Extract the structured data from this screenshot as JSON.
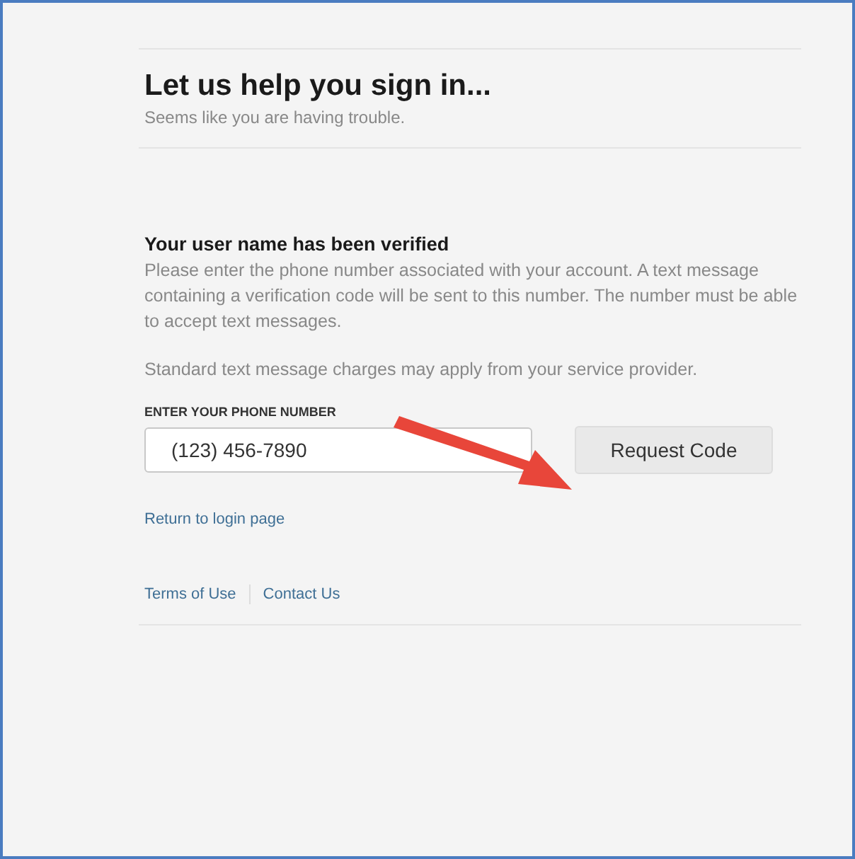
{
  "header": {
    "title": "Let us help you sign in...",
    "subtitle": "Seems like you are having trouble."
  },
  "section": {
    "title": "Your user name has been verified",
    "paragraphs": [
      "Please enter the phone number associated with your account. A text message containing a verification code will be sent to this number. The number must be able to accept text messages.",
      "Standard text message charges may apply from your service provider."
    ]
  },
  "phone": {
    "label": "ENTER YOUR PHONE NUMBER",
    "value": "(123) 456-7890"
  },
  "button": "Request Code",
  "return_link": "Return to login page",
  "footer_links": [
    "Terms of Use",
    "Contact Us"
  ]
}
